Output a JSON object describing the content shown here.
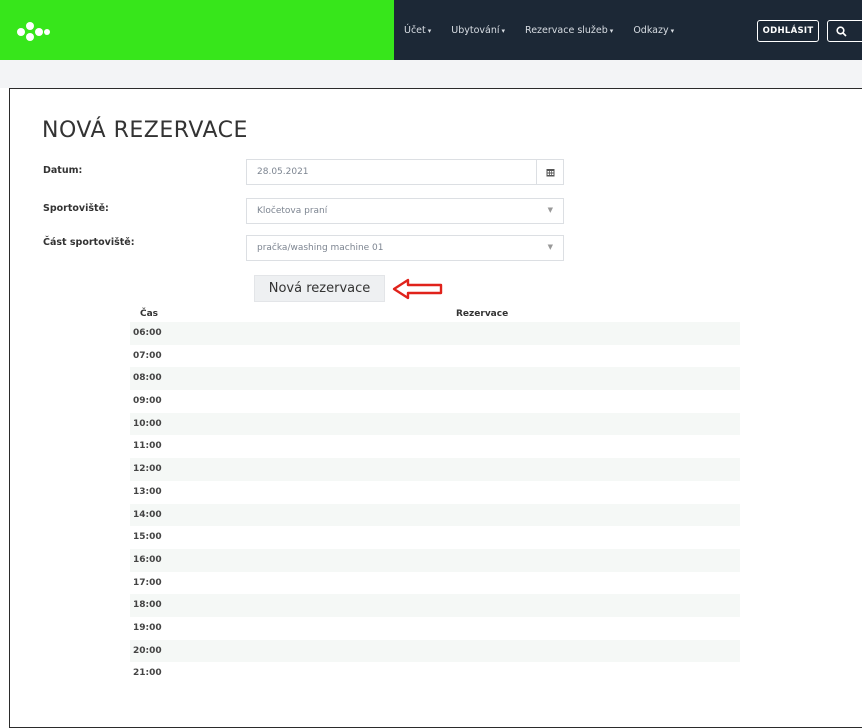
{
  "nav": {
    "items": [
      {
        "label": "Účet",
        "caret": "▾"
      },
      {
        "label": "Ubytování",
        "caret": "▾"
      },
      {
        "label": "Rezervace služeb",
        "caret": "▾"
      },
      {
        "label": "Odkazy",
        "caret": "▾"
      }
    ],
    "logout_label": "ODHLÁSIT",
    "extra_icon": "search-icon"
  },
  "page": {
    "title": "NOVÁ REZERVACE"
  },
  "form": {
    "datum_label": "Datum:",
    "datum_value": "28.05.2021",
    "datum_icon": "calendar-icon",
    "sportoviste_label": "Sportoviště:",
    "sportoviste_value": "Kločetova praní",
    "cast_label": "Část sportoviště:",
    "cast_value": "pračka/washing machine 01",
    "new_button_label": "Nová rezervace"
  },
  "table": {
    "col_time": "Čas",
    "col_reservation": "Rezervace",
    "times": [
      "06:00",
      "07:00",
      "08:00",
      "09:00",
      "10:00",
      "11:00",
      "12:00",
      "13:00",
      "14:00",
      "15:00",
      "16:00",
      "17:00",
      "18:00",
      "19:00",
      "20:00",
      "21:00"
    ]
  },
  "colors": {
    "brand_green": "#37e61b",
    "nav_dark": "#1c2836",
    "arrow_red": "#e0221b"
  }
}
